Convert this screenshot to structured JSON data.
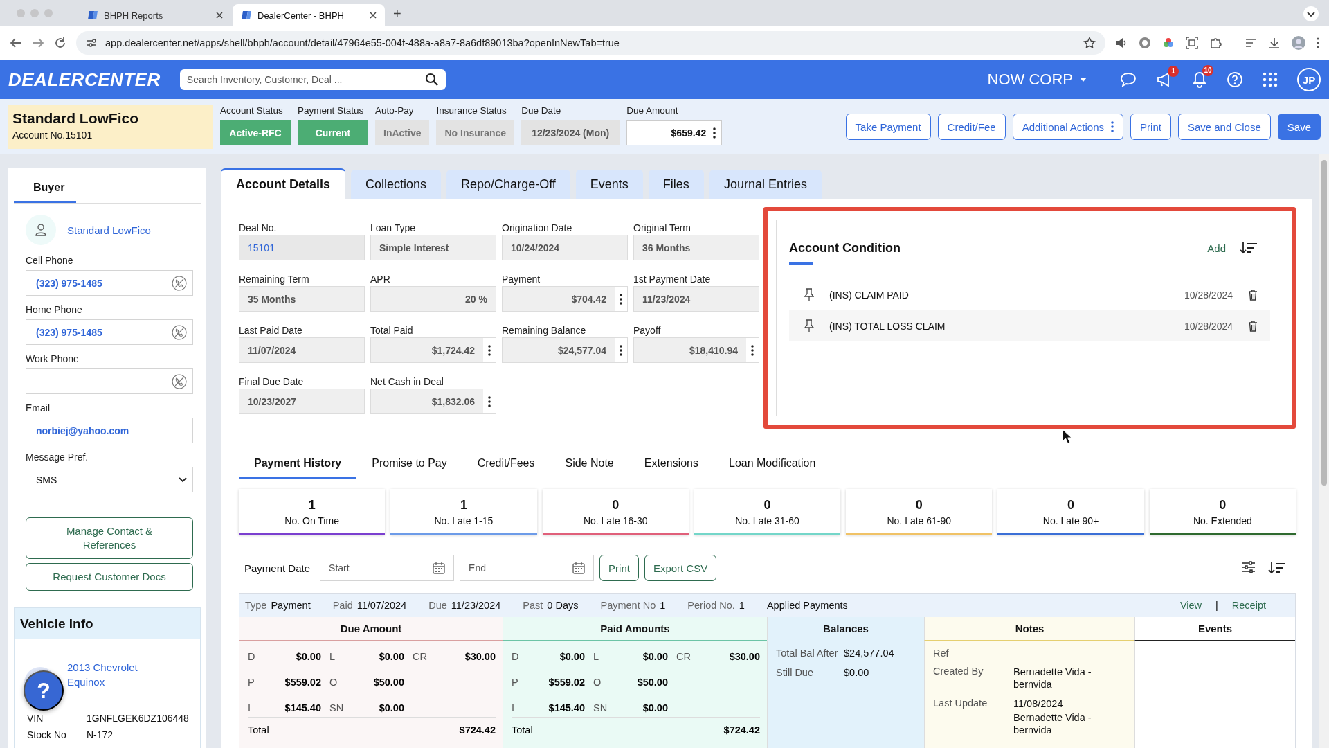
{
  "browser": {
    "tabs": [
      {
        "title": "BHPH Reports",
        "selected": false
      },
      {
        "title": "DealerCenter - BHPH",
        "selected": true
      }
    ],
    "new_tab": "+",
    "url": "app.dealercenter.net/apps/shell/bhph/account/detail/47964e55-004f-488a-a8a7-8a6df89013ba?openInNewTab=true"
  },
  "app_header": {
    "logo": "DEALERCENTER",
    "search": {
      "placeholder": "Search Inventory, Customer, Deal ..."
    },
    "company": "NOW CORP",
    "announcements_badge": "1",
    "notifications_badge": "10",
    "avatar": "JP"
  },
  "account_bar": {
    "name": "Standard LowFico",
    "account_label": "Account No.",
    "account_no": "15101",
    "statuses": [
      {
        "label": "Account Status",
        "value": "Active-RFC",
        "kind": "success"
      },
      {
        "label": "Payment Status",
        "value": "Current",
        "kind": "success"
      },
      {
        "label": "Auto-Pay",
        "value": "InActive",
        "kind": "muted"
      },
      {
        "label": "Insurance Status",
        "value": "No Insurance",
        "kind": "muted"
      },
      {
        "label": "Due Date",
        "value": "12/23/2024 (Mon)",
        "kind": "readonly"
      },
      {
        "label": "Due Amount",
        "value": "$659.42",
        "kind": "amount"
      }
    ],
    "actions": [
      {
        "label": "Take Payment",
        "kind": "outline"
      },
      {
        "label": "Credit/Fee",
        "kind": "outline"
      },
      {
        "label": "Additional Actions",
        "kind": "menu"
      },
      {
        "label": "Print",
        "kind": "outline"
      },
      {
        "label": "Save and Close",
        "kind": "outline"
      },
      {
        "label": "Save",
        "kind": "primary"
      }
    ]
  },
  "sidebar": {
    "tabs": [
      {
        "label": "Buyer",
        "selected": true
      }
    ],
    "buyer_name": "Standard LowFico",
    "fields": [
      {
        "label": "Cell Phone",
        "value": "(323) 975-1485",
        "kind": "phone"
      },
      {
        "label": "Home Phone",
        "value": "(323) 975-1485",
        "kind": "phone"
      },
      {
        "label": "Work Phone",
        "kind": "phone"
      },
      {
        "label": "Email",
        "value": "norbiej@yahoo.com",
        "kind": "text"
      },
      {
        "label": "Message Pref.",
        "value": "SMS",
        "kind": "select"
      }
    ],
    "buttons": [
      "Manage Contact & References",
      "Request Customer Docs"
    ],
    "vehicle_info": {
      "title": "Vehicle Info",
      "vehicle": "2013 Chevrolet Equinox",
      "details": [
        {
          "label": "VIN",
          "value": "1GNFLGEK6DZ106448"
        },
        {
          "label": "Stock No",
          "value": "N-172"
        }
      ]
    }
  },
  "help_button": "?",
  "main": {
    "tabs": [
      {
        "label": "Account Details",
        "selected": true
      },
      {
        "label": "Collections",
        "selected": false
      },
      {
        "label": "Repo/Charge-Off",
        "selected": false
      },
      {
        "label": "Events",
        "selected": false
      },
      {
        "label": "Files",
        "selected": false
      },
      {
        "label": "Journal Entries",
        "selected": false
      }
    ],
    "fields": [
      {
        "label": "Deal No.",
        "value": "15101",
        "kind": "link",
        "menu": false
      },
      {
        "label": "Loan Type",
        "value": "Simple Interest",
        "kind": "text",
        "menu": false
      },
      {
        "label": "Origination Date",
        "value": "10/24/2024",
        "kind": "text",
        "menu": false
      },
      {
        "label": "Original Term",
        "value": "36 Months",
        "kind": "text",
        "menu": false
      },
      {
        "label": "Remaining Term",
        "value": "35 Months",
        "kind": "text",
        "menu": false
      },
      {
        "label": "APR",
        "value": "20 %",
        "kind": "number",
        "menu": false
      },
      {
        "label": "Payment",
        "value": "$704.42",
        "kind": "number",
        "menu": true
      },
      {
        "label": "1st Payment Date",
        "value": "11/23/2024",
        "kind": "text",
        "menu": false
      },
      {
        "label": "Last Paid Date",
        "value": "11/07/2024",
        "kind": "text",
        "menu": false
      },
      {
        "label": "Total Paid",
        "value": "$1,724.42",
        "kind": "number",
        "menu": true
      },
      {
        "label": "Remaining Balance",
        "value": "$24,577.04",
        "kind": "number",
        "menu": true
      },
      {
        "label": "Payoff",
        "value": "$18,410.94",
        "kind": "number",
        "menu": true
      },
      {
        "label": "Final Due Date",
        "value": "10/23/2027",
        "kind": "text",
        "menu": false
      },
      {
        "label": "Net Cash in Deal",
        "value": "$1,832.06",
        "kind": "number",
        "menu": true
      }
    ],
    "account_condition": {
      "title": "Account Condition",
      "add": "Add",
      "items": [
        {
          "text": "(INS) CLAIM PAID",
          "date": "10/28/2024"
        },
        {
          "text": "(INS) TOTAL LOSS CLAIM",
          "date": "10/28/2024"
        }
      ]
    }
  },
  "payment_history": {
    "tabs": [
      {
        "label": "Payment History",
        "selected": true
      },
      {
        "label": "Promise to Pay",
        "selected": false
      },
      {
        "label": "Credit/Fees",
        "selected": false
      },
      {
        "label": "Side Note",
        "selected": false
      },
      {
        "label": "Extensions",
        "selected": false
      },
      {
        "label": "Loan Modification",
        "selected": false
      }
    ],
    "stats": [
      {
        "value": "1",
        "label": "No. On Time",
        "color": "#7b3fcf"
      },
      {
        "value": "1",
        "label": "No. Late 1-15",
        "color": "#6d9be8"
      },
      {
        "value": "0",
        "label": "No. Late 16-30",
        "color": "#e0607a"
      },
      {
        "value": "0",
        "label": "No. Late 31-60",
        "color": "#74d6c9"
      },
      {
        "value": "0",
        "label": "No. Late 61-90",
        "color": "#f0c266"
      },
      {
        "value": "0",
        "label": "No. Late 90+",
        "color": "#3b6fd6"
      },
      {
        "value": "0",
        "label": "No. Extended",
        "color": "#2f6a2f"
      }
    ],
    "filter": {
      "label": "Payment Date",
      "start": {
        "placeholder": "Start"
      },
      "end": {
        "placeholder": "End"
      },
      "buttons": [
        "Print",
        "Export CSV"
      ]
    },
    "record": {
      "summary": [
        {
          "label": "Type",
          "value": "Payment"
        },
        {
          "label": "Paid",
          "value": "11/07/2024"
        },
        {
          "label": "Due",
          "value": "11/23/2024"
        },
        {
          "label": "Past",
          "value": "0 Days"
        },
        {
          "label": "Payment No",
          "value": "1"
        },
        {
          "label": "Period No.",
          "value": "1"
        }
      ],
      "applied": "Applied Payments",
      "links": [
        "View",
        "Receipt"
      ],
      "separator": "|",
      "columns": [
        "Due Amount",
        "Paid Amounts",
        "Balances",
        "Notes",
        "Events"
      ],
      "due": {
        "rows": [
          {
            "cells": [
              {
                "label": "D",
                "value": "$0.00"
              },
              {
                "label": "L",
                "value": "$0.00"
              },
              {
                "label": "CR",
                "value": "$30.00"
              }
            ]
          },
          {
            "cells": [
              {
                "label": "P",
                "value": "$559.02"
              },
              {
                "label": "O",
                "value": "$50.00"
              }
            ]
          },
          {
            "cells": [
              {
                "label": "I",
                "value": "$145.40"
              },
              {
                "label": "SN",
                "value": "$0.00"
              }
            ]
          }
        ],
        "total_label": "Total",
        "total": "$724.42"
      },
      "paid": {
        "rows": [
          {
            "cells": [
              {
                "label": "D",
                "value": "$0.00"
              },
              {
                "label": "L",
                "value": "$0.00"
              },
              {
                "label": "CR",
                "value": "$30.00"
              }
            ]
          },
          {
            "cells": [
              {
                "label": "P",
                "value": "$559.02"
              },
              {
                "label": "O",
                "value": "$50.00"
              }
            ]
          },
          {
            "cells": [
              {
                "label": "I",
                "value": "$145.40"
              },
              {
                "label": "SN",
                "value": "$0.00"
              }
            ]
          }
        ],
        "total_label": "Total",
        "total": "$724.42"
      },
      "balances": [
        {
          "label": "Total Bal After",
          "value": "$24,577.04"
        },
        {
          "label": "Still Due",
          "value": "$0.00"
        }
      ],
      "notes": [
        {
          "label": "Ref"
        },
        {
          "label": "Created By",
          "values": [
            "Bernadette Vida - bernvida"
          ]
        },
        {
          "label": "Last Update",
          "values": [
            "11/08/2024",
            "Bernadette Vida - bernvida"
          ]
        }
      ]
    }
  }
}
